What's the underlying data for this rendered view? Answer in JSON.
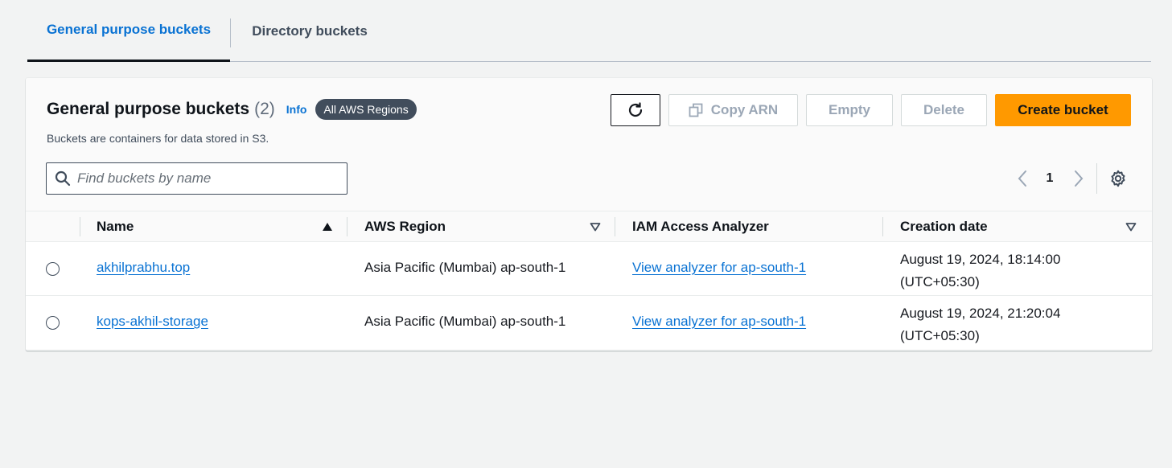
{
  "tabs": [
    {
      "label": "General purpose buckets",
      "active": true
    },
    {
      "label": "Directory buckets",
      "active": false
    }
  ],
  "card": {
    "title": "General purpose buckets",
    "count": "(2)",
    "info": "Info",
    "badge": "All AWS Regions",
    "description": "Buckets are containers for data stored in S3."
  },
  "actions": {
    "refresh_icon": "refresh-icon",
    "copy_arn": "Copy ARN",
    "empty": "Empty",
    "delete": "Delete",
    "create": "Create bucket"
  },
  "search": {
    "placeholder": "Find buckets by name",
    "value": ""
  },
  "pagination": {
    "current_page": "1"
  },
  "table": {
    "columns": [
      "Name",
      "AWS Region",
      "IAM Access Analyzer",
      "Creation date"
    ],
    "sort": {
      "column": "Name",
      "direction": "ascending"
    },
    "rows": [
      {
        "name": "akhilprabhu.top",
        "region": "Asia Pacific (Mumbai) ap-south-1",
        "iam": "View analyzer for ap-south-1",
        "date_line1": "August 19, 2024, 18:14:00",
        "date_line2": "(UTC+05:30)"
      },
      {
        "name": "kops-akhil-storage",
        "region": "Asia Pacific (Mumbai) ap-south-1",
        "iam": "View analyzer for ap-south-1",
        "date_line1": "August 19, 2024, 21:20:04",
        "date_line2": "(UTC+05:30)"
      }
    ]
  },
  "colors": {
    "link": "#0972d3",
    "primary_button": "#ff9900",
    "badge_bg": "#414d5c",
    "page_bg": "#f2f3f3"
  }
}
